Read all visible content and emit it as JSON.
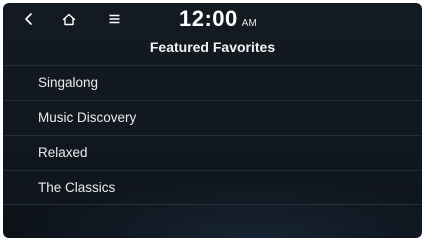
{
  "status_bar": {
    "nav_icons": [
      "chevron-left-icon",
      "home-icon",
      "menu-icon"
    ],
    "time": "12:00",
    "ampm": "AM"
  },
  "page": {
    "title": "Featured Favorites"
  },
  "list": {
    "items": [
      {
        "label": "Singalong"
      },
      {
        "label": "Music Discovery"
      },
      {
        "label": "Relaxed"
      },
      {
        "label": "The Classics"
      }
    ]
  },
  "colors": {
    "background": "#131922",
    "text": "#ececec",
    "divider": "#252c35"
  }
}
